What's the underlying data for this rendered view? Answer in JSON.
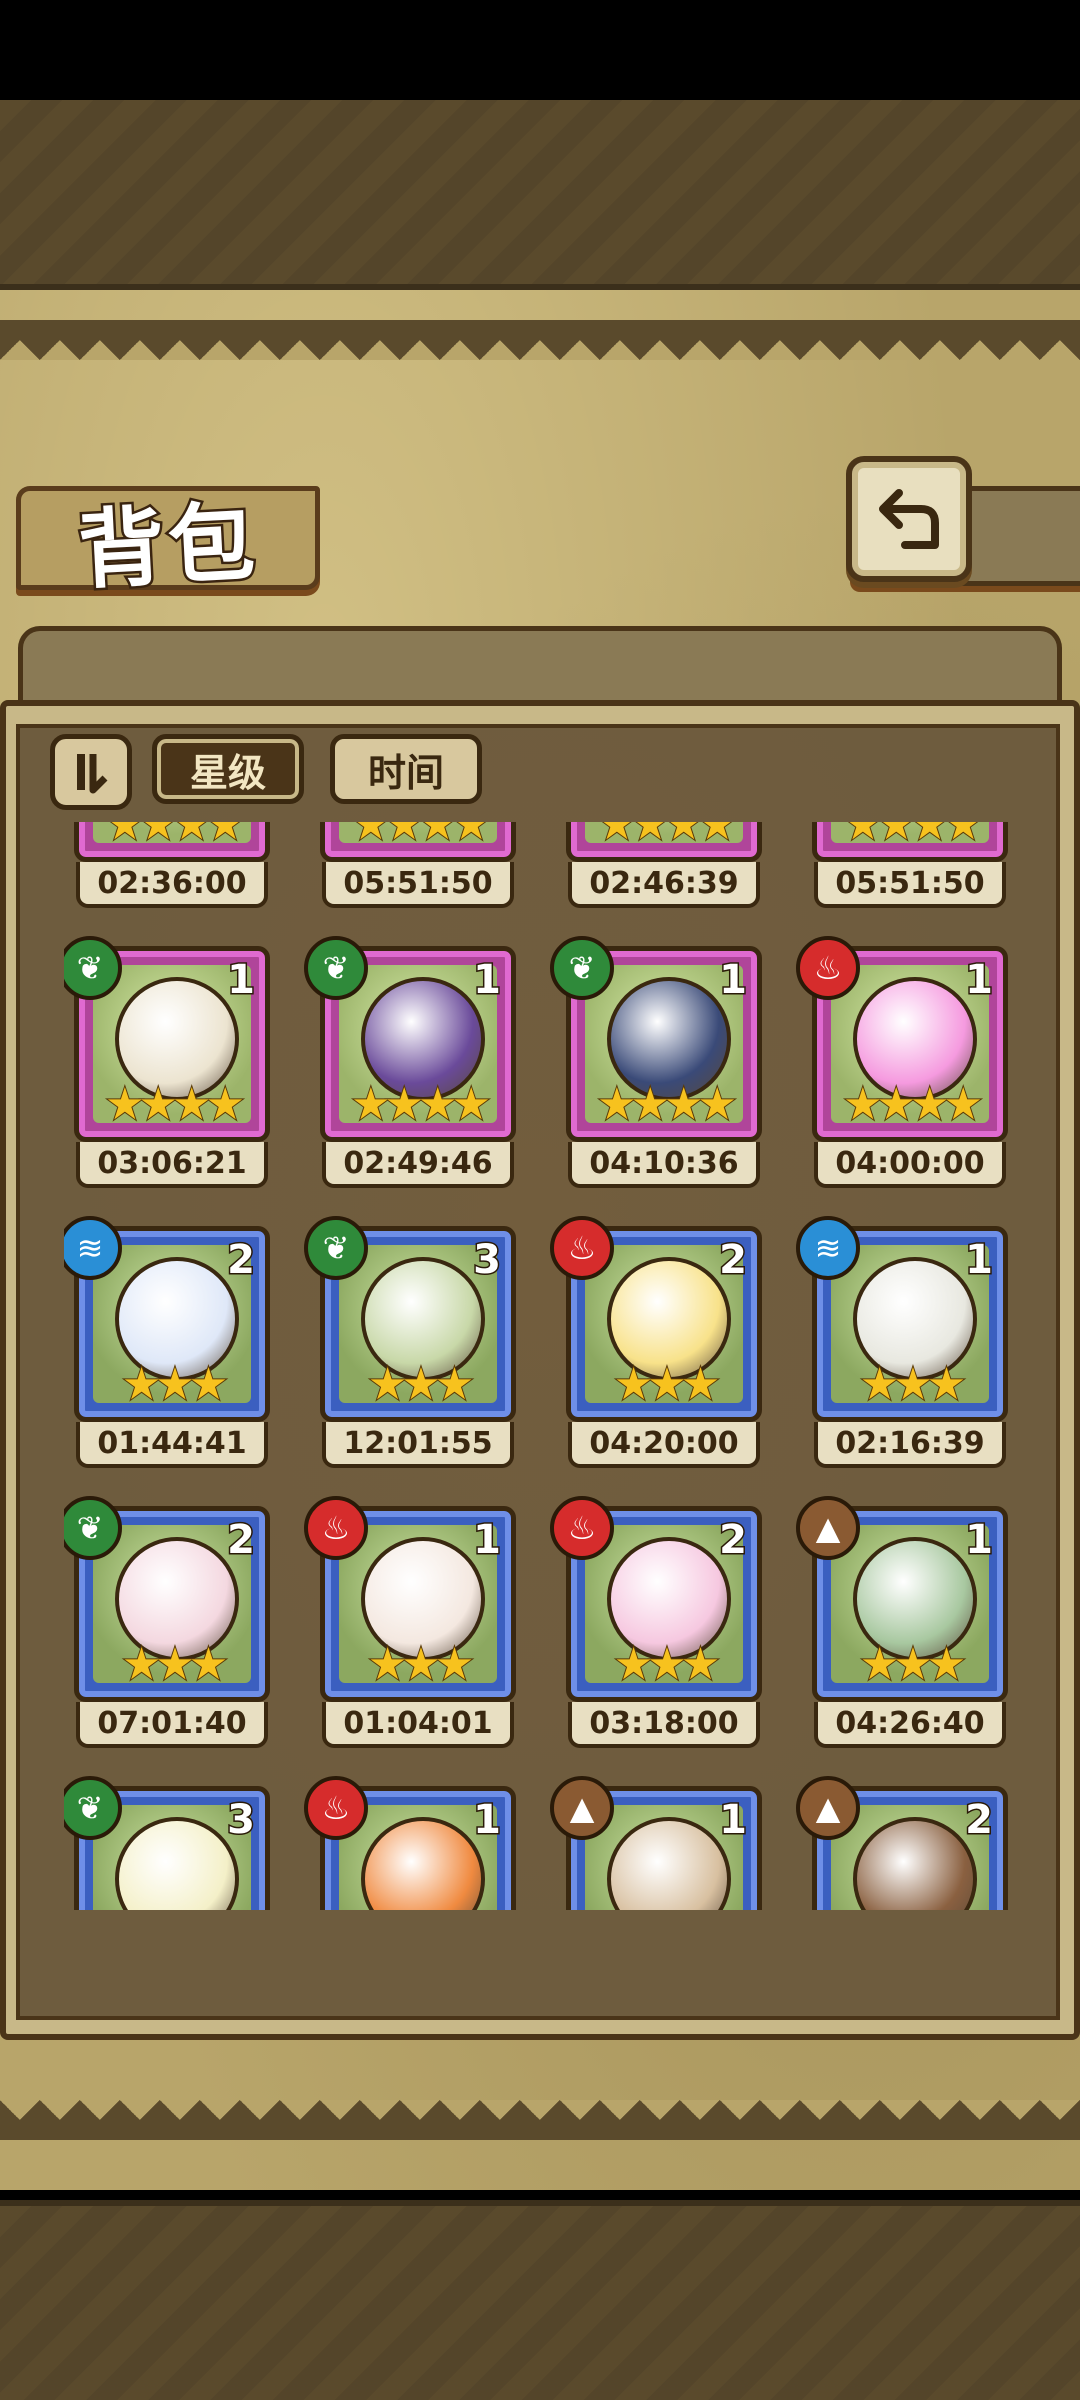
{
  "header": {
    "title": "背包"
  },
  "sort": {
    "star_label": "星级",
    "time_label": "时间"
  },
  "colors": {
    "purple_card": "#b0459a",
    "blue_card": "#3b5fc0",
    "star": "#f7c21e",
    "grass": "#2f8a3a",
    "fire": "#d62c2c",
    "water": "#2a8fd6",
    "earth": "#8a5a32"
  },
  "pets": [
    {
      "element": "grass",
      "element_icon": "leaf-icon",
      "count": "",
      "stars": "★★★★",
      "timer": "02:36:00",
      "rarity": "purple",
      "tint": "#d9c7d0"
    },
    {
      "element": "grass",
      "element_icon": "leaf-icon",
      "count": "",
      "stars": "★★★★",
      "timer": "05:51:50",
      "rarity": "purple",
      "tint": "#7a5aa0"
    },
    {
      "element": "grass",
      "element_icon": "leaf-icon",
      "count": "",
      "stars": "★★★★",
      "timer": "02:46:39",
      "rarity": "purple",
      "tint": "#4a5a8a"
    },
    {
      "element": "fire",
      "element_icon": "flame-icon",
      "count": "",
      "stars": "★★★★",
      "timer": "05:51:50",
      "rarity": "purple",
      "tint": "#f0a0d8"
    },
    {
      "element": "grass",
      "element_icon": "leaf-icon",
      "count": "1",
      "stars": "★★★★",
      "timer": "03:06:21",
      "rarity": "purple",
      "tint": "#ece4d0"
    },
    {
      "element": "grass",
      "element_icon": "leaf-icon",
      "count": "1",
      "stars": "★★★★",
      "timer": "02:49:46",
      "rarity": "purple",
      "tint": "#6a4a9a"
    },
    {
      "element": "grass",
      "element_icon": "leaf-icon",
      "count": "1",
      "stars": "★★★★",
      "timer": "04:10:36",
      "rarity": "purple",
      "tint": "#3a4a78"
    },
    {
      "element": "fire",
      "element_icon": "flame-icon",
      "count": "1",
      "stars": "★★★★",
      "timer": "04:00:00",
      "rarity": "purple",
      "tint": "#f59adf"
    },
    {
      "element": "water",
      "element_icon": "water-icon",
      "count": "2",
      "stars": "★★★",
      "timer": "01:44:41",
      "rarity": "blue",
      "tint": "#dfe8f8"
    },
    {
      "element": "grass",
      "element_icon": "leaf-icon",
      "count": "3",
      "stars": "★★★",
      "timer": "12:01:55",
      "rarity": "blue",
      "tint": "#c8d8a8"
    },
    {
      "element": "fire",
      "element_icon": "flame-icon",
      "count": "2",
      "stars": "★★★",
      "timer": "04:20:00",
      "rarity": "blue",
      "tint": "#f8e28a"
    },
    {
      "element": "water",
      "element_icon": "water-icon",
      "count": "1",
      "stars": "★★★",
      "timer": "02:16:39",
      "rarity": "blue",
      "tint": "#e8e8e0"
    },
    {
      "element": "grass",
      "element_icon": "leaf-icon",
      "count": "2",
      "stars": "★★★",
      "timer": "07:01:40",
      "rarity": "blue",
      "tint": "#f4d8e0"
    },
    {
      "element": "fire",
      "element_icon": "flame-icon",
      "count": "1",
      "stars": "★★★",
      "timer": "01:04:01",
      "rarity": "blue",
      "tint": "#f4e8e0"
    },
    {
      "element": "fire",
      "element_icon": "flame-icon",
      "count": "2",
      "stars": "★★★",
      "timer": "03:18:00",
      "rarity": "blue",
      "tint": "#f6c8e0"
    },
    {
      "element": "earth",
      "element_icon": "mountain-icon",
      "count": "1",
      "stars": "★★★",
      "timer": "04:26:40",
      "rarity": "blue",
      "tint": "#a8c8a0"
    },
    {
      "element": "grass",
      "element_icon": "leaf-icon",
      "count": "3",
      "stars": "",
      "timer": "",
      "rarity": "blue",
      "tint": "#f4f0c8"
    },
    {
      "element": "fire",
      "element_icon": "flame-icon",
      "count": "1",
      "stars": "",
      "timer": "",
      "rarity": "blue",
      "tint": "#f08a40"
    },
    {
      "element": "earth",
      "element_icon": "mountain-icon",
      "count": "1",
      "stars": "",
      "timer": "",
      "rarity": "blue",
      "tint": "#d8c0a0"
    },
    {
      "element": "earth",
      "element_icon": "mountain-icon",
      "count": "2",
      "stars": "",
      "timer": "",
      "rarity": "blue",
      "tint": "#8a6040"
    }
  ]
}
